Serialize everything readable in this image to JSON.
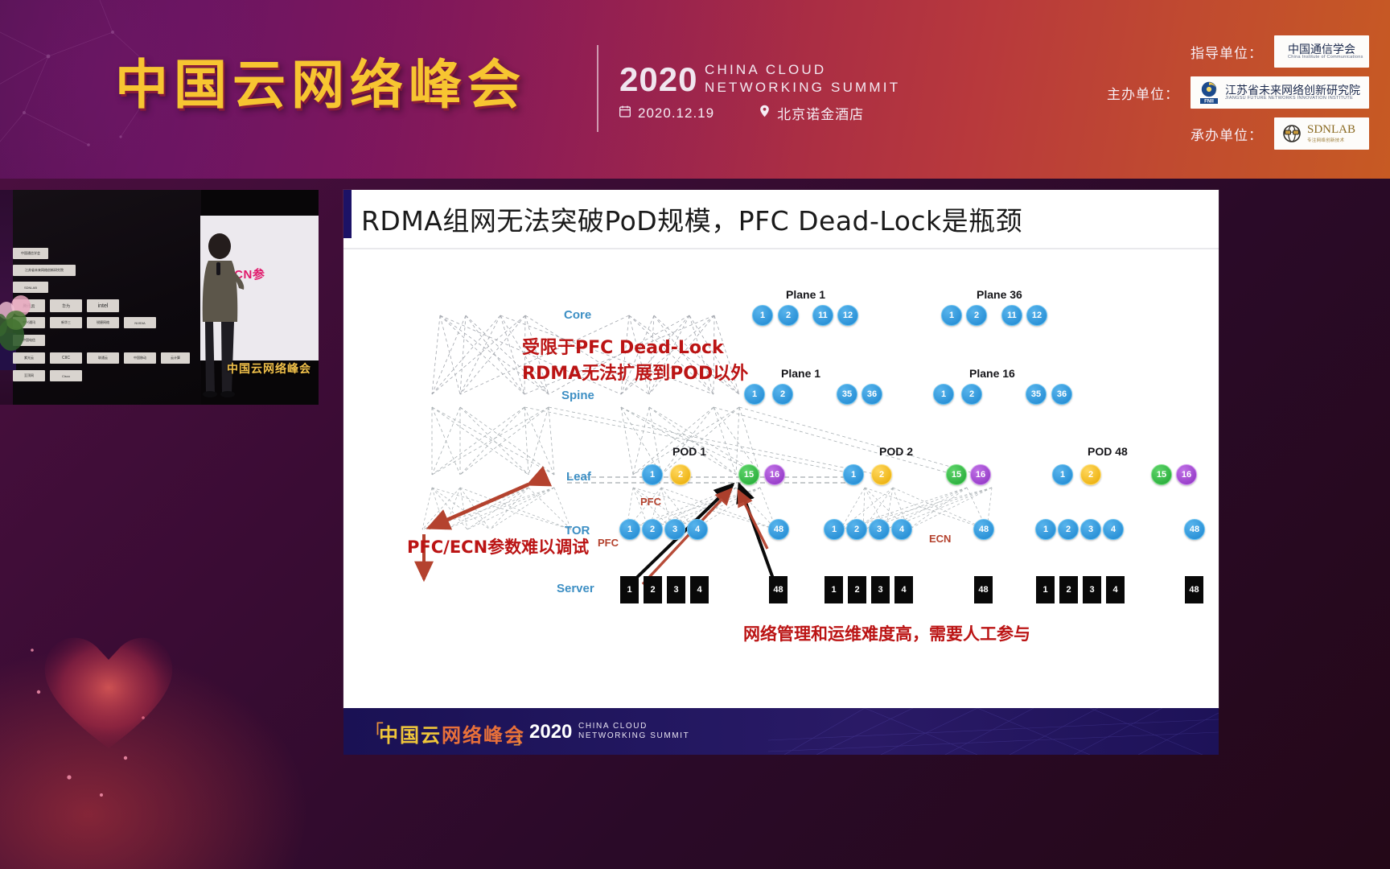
{
  "header": {
    "title_cn": "中国云网络峰会",
    "year": "2020",
    "title_en_line1": "CHINA CLOUD",
    "title_en_line2": "NETWORKING SUMMIT",
    "date": "2020.12.19",
    "venue": "北京诺金酒店",
    "calendar_icon": "calendar-icon",
    "location_icon": "location-pin-icon",
    "sponsors": [
      {
        "label": "指导单位：",
        "logo_cn": "中国通信学会",
        "logo_en": "China Institute of Communications",
        "mark": "CIC"
      },
      {
        "label": "主办单位：",
        "logo_cn": "江苏省未来网络创新研究院",
        "logo_en": "JIANGSU FUTURE NETWORKS INNOVATION INSTITUTE",
        "mark": "FNII"
      },
      {
        "label": "承办单位：",
        "logo_cn": "专注网络创新技术",
        "logo_en": "SDNLAB",
        "mark": "SDN"
      }
    ]
  },
  "video": {
    "name": "speaker-stage-video",
    "screen_text": "FC/ECN参",
    "bottom_text": "中国云网络峰会",
    "wall_logos": [
      "中国通信学会",
      "江苏省未来网络创新研究院",
      "SDNLAB",
      "腾讯云",
      "华为",
      "intel",
      "中兴通讯",
      "新华三",
      "锐捷网络",
      "NVIDIA",
      "中国电信",
      "紫光云",
      "CIIC",
      "联通云",
      "中国移动",
      "云计算",
      "至顶网",
      "Cisco"
    ]
  },
  "slide": {
    "title": "RDMA组网无法突破PoD规模，PFC Dead-Lock是瓶颈",
    "layer_labels": [
      "Core",
      "Spine",
      "Leaf",
      "TOR",
      "Server"
    ],
    "annotations": {
      "top_red_line1": "受限于PFC Dead-Lock",
      "top_red_line2": "RDMA无法扩展到POD以外",
      "left_red": "PFC/ECN参数难以调试",
      "bottom_red": "网络管理和运维难度高，需要人工参与",
      "pfc_leaf": "PFC",
      "pfc_tor": "PFC",
      "ecn": "ECN"
    },
    "core_groups": [
      {
        "label": "Plane 1",
        "nodes": [
          "1",
          "2",
          "11",
          "12"
        ]
      },
      {
        "label": "Plane 36",
        "nodes": [
          "1",
          "2",
          "11",
          "12"
        ]
      }
    ],
    "spine_groups": [
      {
        "label": "Plane 1",
        "nodes": [
          "1",
          "2",
          "35",
          "36"
        ]
      },
      {
        "label": "Plane 16",
        "nodes": [
          "1",
          "2",
          "35",
          "36"
        ]
      }
    ],
    "pods": [
      {
        "label": "POD 1",
        "leaf": [
          "1",
          "2",
          "15",
          "16"
        ],
        "tor_left": [
          "1",
          "2",
          "3",
          "4"
        ],
        "tor_right": [
          "48"
        ],
        "servers_left": [
          "1",
          "2",
          "3",
          "4"
        ],
        "servers_right": [
          "48"
        ]
      },
      {
        "label": "POD 2",
        "leaf": [
          "1",
          "2",
          "15",
          "16"
        ],
        "tor_left": [
          "1",
          "2",
          "3",
          "4"
        ],
        "tor_right": [
          "48"
        ],
        "servers_left": [
          "1",
          "2",
          "3",
          "4"
        ],
        "servers_right": [
          "48"
        ]
      },
      {
        "label": "POD 48",
        "leaf": [
          "1",
          "2",
          "15",
          "16"
        ],
        "tor_left": [
          "1",
          "2",
          "3",
          "4"
        ],
        "tor_right": [
          "48"
        ],
        "servers_left": [
          "1",
          "2",
          "3",
          "4"
        ],
        "servers_right": [
          "48"
        ]
      }
    ],
    "colors": {
      "node_blue": "#1c86d0",
      "node_yellow": "#e8a900",
      "node_green": "#1fa532",
      "node_purple": "#8b2fc0",
      "server_black": "#090909",
      "annotation_red": "#bb1414",
      "layer_label_blue": "#3d8fc4",
      "link_gray": "#8b8f96",
      "arrow_red": "#b4422e"
    },
    "footer": {
      "cn_a": "中国云",
      "cn_b": "网络峰会",
      "year": "2020",
      "en_line1": "CHINA CLOUD",
      "en_line2": "NETWORKING SUMMIT",
      "bracket_open": "「",
      "bracket_close": "」"
    }
  }
}
